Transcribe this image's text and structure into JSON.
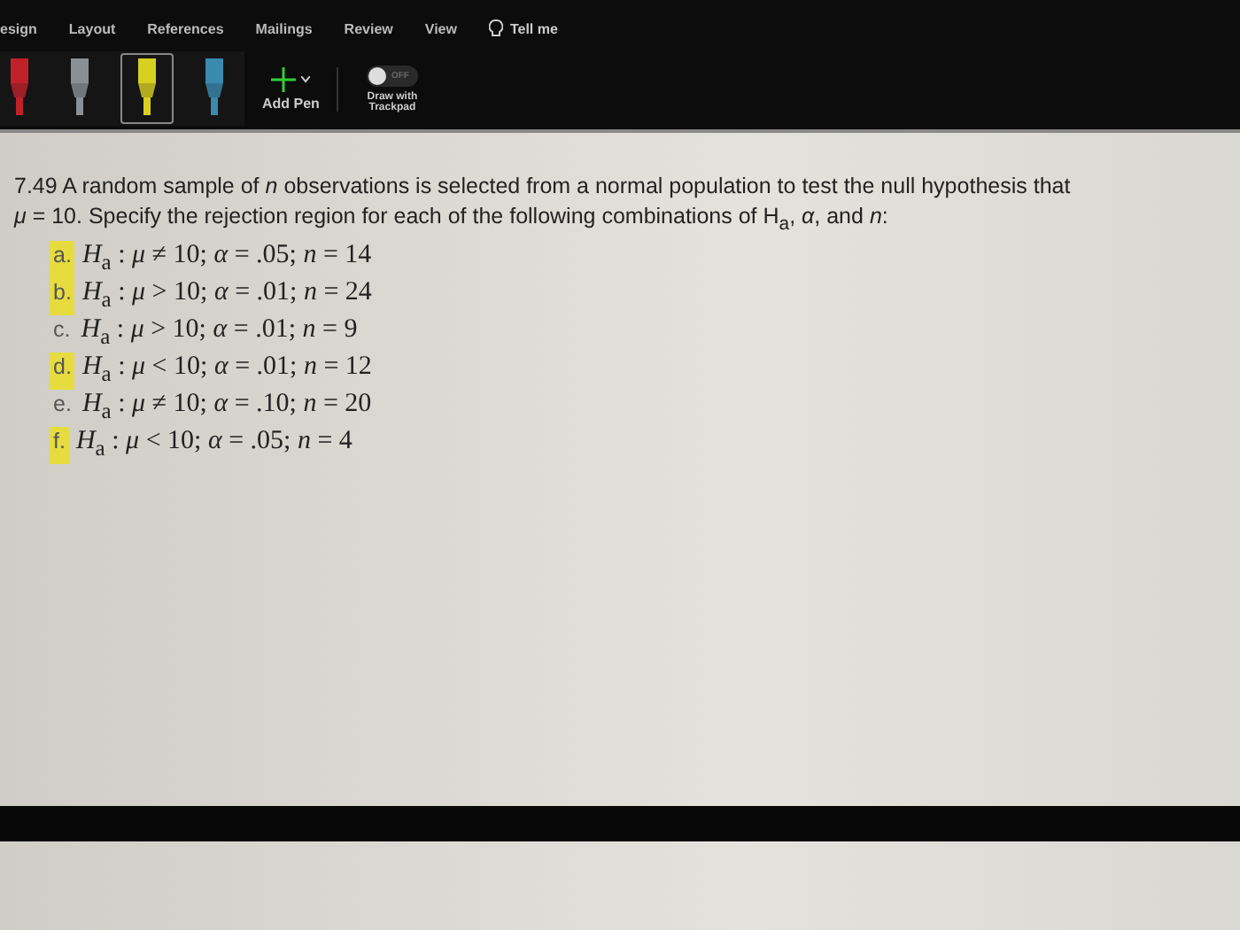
{
  "ribbon": {
    "tabs": [
      {
        "label": "esign",
        "selected": false
      },
      {
        "label": "Layout",
        "selected": false
      },
      {
        "label": "References",
        "selected": false
      },
      {
        "label": "Mailings",
        "selected": false
      },
      {
        "label": "Review",
        "selected": false
      },
      {
        "label": "View",
        "selected": false
      }
    ],
    "tell_me": "Tell me",
    "pens": [
      {
        "color": "#c0202a",
        "selected": false
      },
      {
        "color": "#8a9094",
        "selected": false
      },
      {
        "color": "#d8d020",
        "selected": true
      },
      {
        "color": "#3a8ab0",
        "selected": false
      }
    ],
    "add_pen": "Add Pen",
    "trackpad": {
      "toggle_label": "OFF",
      "on": false,
      "label": "Draw with Trackpad"
    }
  },
  "document": {
    "intro": "7.49 A random sample of *n* observations is selected from a normal population to test the null hypothesis that",
    "intro_2": "*μ* = 10. Specify the rejection region for each of the following combinations of H$_{a}$, *α*, and *n*:",
    "items": [
      {
        "label": "a.",
        "text": "*H*$_{a}$ : *μ* ≠ 10; *α* = .05; *n* = 14",
        "highlighted": true
      },
      {
        "label": "b.",
        "text": "*H*$_{a}$ : *μ* > 10; *α* = .01; *n* = 24",
        "highlighted": true
      },
      {
        "label": "c.",
        "text": "*H*$_{a}$ : *μ* > 10; *α* = .01; *n* = 9",
        "highlighted": false
      },
      {
        "label": "d.",
        "text": "*H*$_{a}$ : *μ* < 10; *α* = .01; *n* = 12",
        "highlighted": true
      },
      {
        "label": "e.",
        "text": "*H*$_{a}$ : *μ* ≠ 10; *α* = .10; *n* = 20",
        "highlighted": false
      },
      {
        "label": "f.",
        "text": "*H*$_{a}$ : *μ* < 10; *α* = .05; *n* = 4",
        "highlighted": true
      }
    ]
  }
}
